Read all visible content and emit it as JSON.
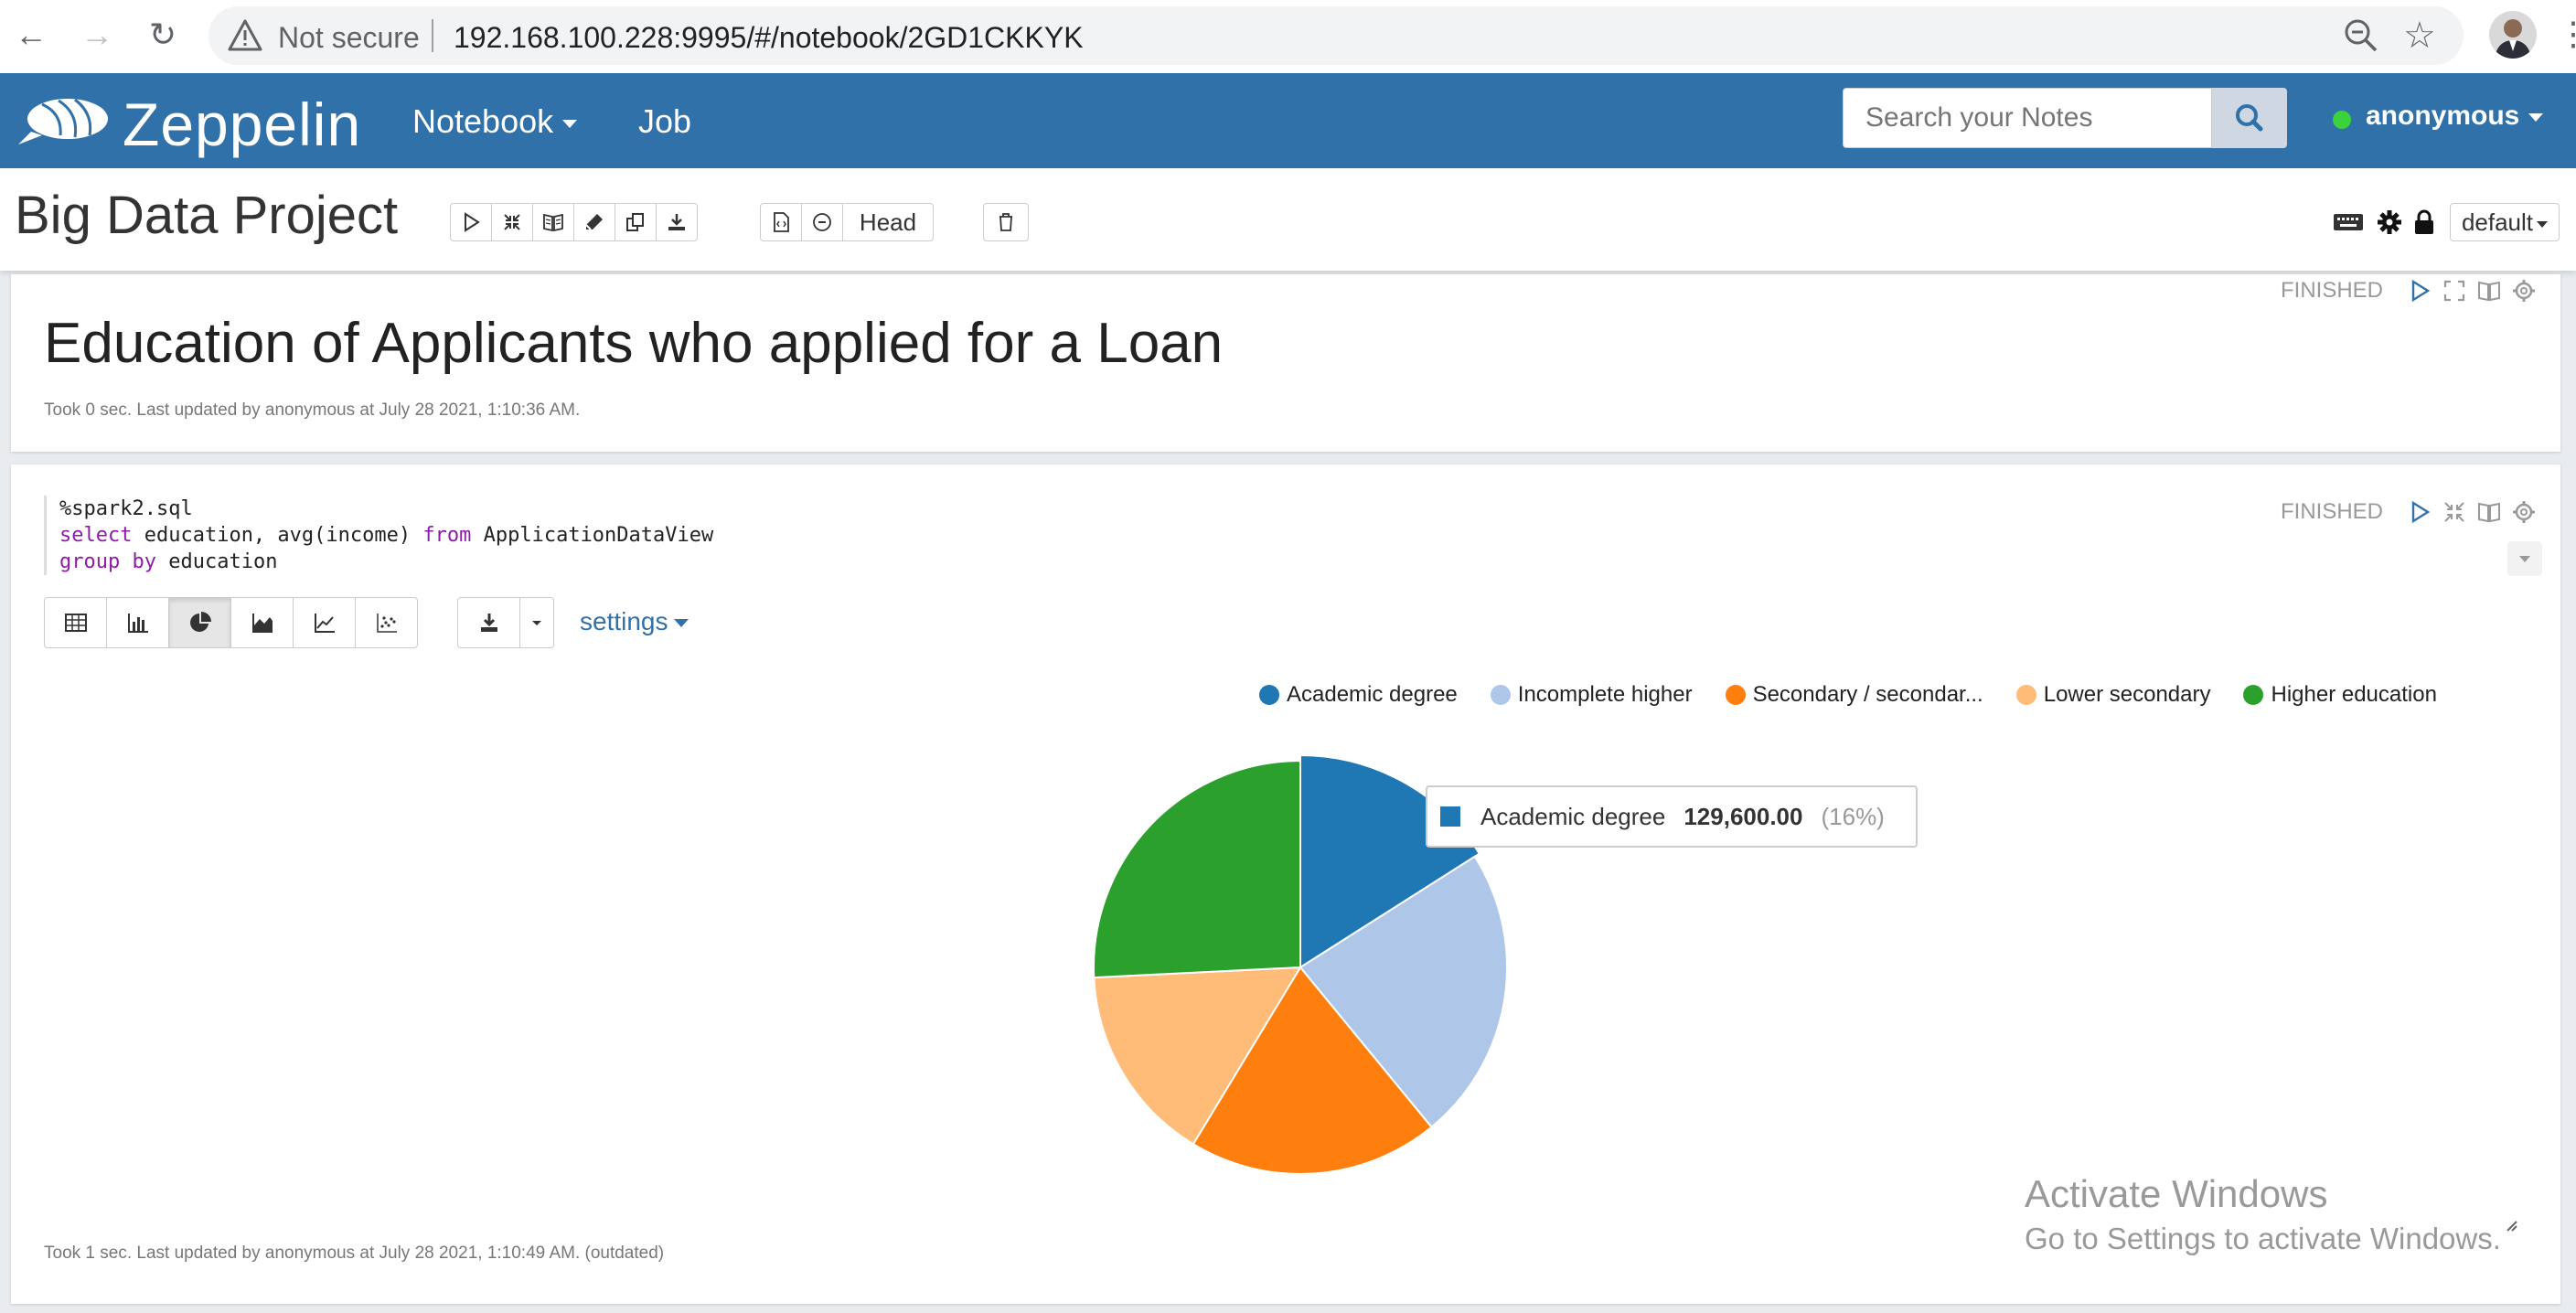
{
  "browser": {
    "secure_label": "Not secure",
    "url": "192.168.100.228:9995/#/notebook/2GD1CKKYK"
  },
  "navbar": {
    "brand": "Zeppelin",
    "notebook": "Notebook",
    "job": "Job",
    "search_placeholder": "Search your Notes",
    "user": "anonymous",
    "status_color": "#3bd33b",
    "bar_color": "#3071a9"
  },
  "notebook": {
    "title": "Big Data Project",
    "revision_label": "Head",
    "interpreter": "default"
  },
  "paragraphs": [
    {
      "status": "FINISHED",
      "heading": "Education of Applicants who applied for a Loan",
      "footer": "Took 0 sec. Last updated by anonymous at July 28 2021, 1:10:36 AM."
    },
    {
      "status": "FINISHED",
      "code": {
        "line1": "%spark2.sql",
        "select_kw": "select",
        "select_rest": " education, avg(income) ",
        "from_kw": "from",
        "from_rest": " ApplicationDataView",
        "group_kw": "group",
        "by_kw": "by",
        "group_rest": " education"
      },
      "settings_label": "settings",
      "footer": "Took 1 sec. Last updated by anonymous at July 28 2021, 1:10:49 AM. (outdated)"
    }
  ],
  "tooltip": {
    "label": "Academic degree",
    "value": "129,600.00",
    "percent": "(16%)"
  },
  "watermark": {
    "line1": "Activate Windows",
    "line2": "Go to Settings to activate Windows."
  },
  "chart_data": {
    "type": "pie",
    "categories": [
      "Academic degree",
      "Incomplete higher",
      "Secondary / secondar...",
      "Lower secondary",
      "Higher education"
    ],
    "values": [
      129600,
      187000,
      159000,
      126000,
      209000
    ],
    "colors": [
      "#1f77b4",
      "#aec7e8",
      "#ff7f0e",
      "#ffbb78",
      "#2ca02c"
    ],
    "legend_position": "top-right"
  }
}
